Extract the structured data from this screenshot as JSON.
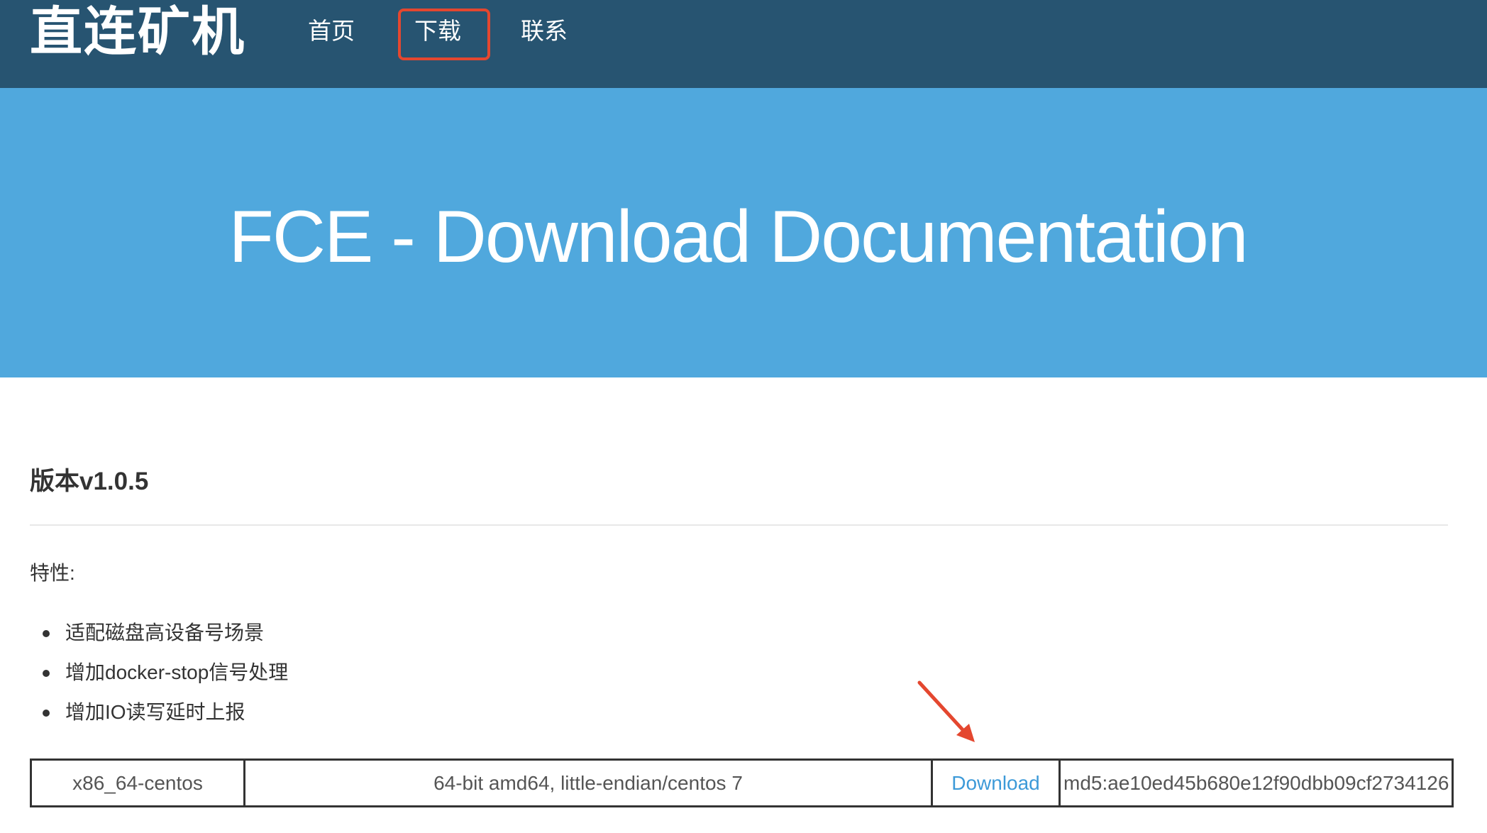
{
  "navbar": {
    "brand": "直连矿机",
    "items": [
      {
        "label": "首页"
      },
      {
        "label": "下载"
      },
      {
        "label": "联系"
      }
    ]
  },
  "hero": {
    "title": "FCE - Download Documentation"
  },
  "release": {
    "version_title": "版本v1.0.5",
    "features_label": "特性:",
    "features": [
      "适配磁盘高设备号场景",
      "增加docker-stop信号处理",
      "增加IO读写延时上报"
    ],
    "downloads": [
      {
        "platform": "x86_64-centos",
        "description": "64-bit amd64, little-endian/centos 7",
        "link_label": "Download",
        "checksum": "md5:ae10ed45b680e12f90dbb09cf2734126"
      }
    ]
  },
  "colors": {
    "navbar_bg": "#275471",
    "hero_bg": "#50a8dd",
    "annotation_red": "#e4472f",
    "link_blue": "#3d9ad8"
  }
}
